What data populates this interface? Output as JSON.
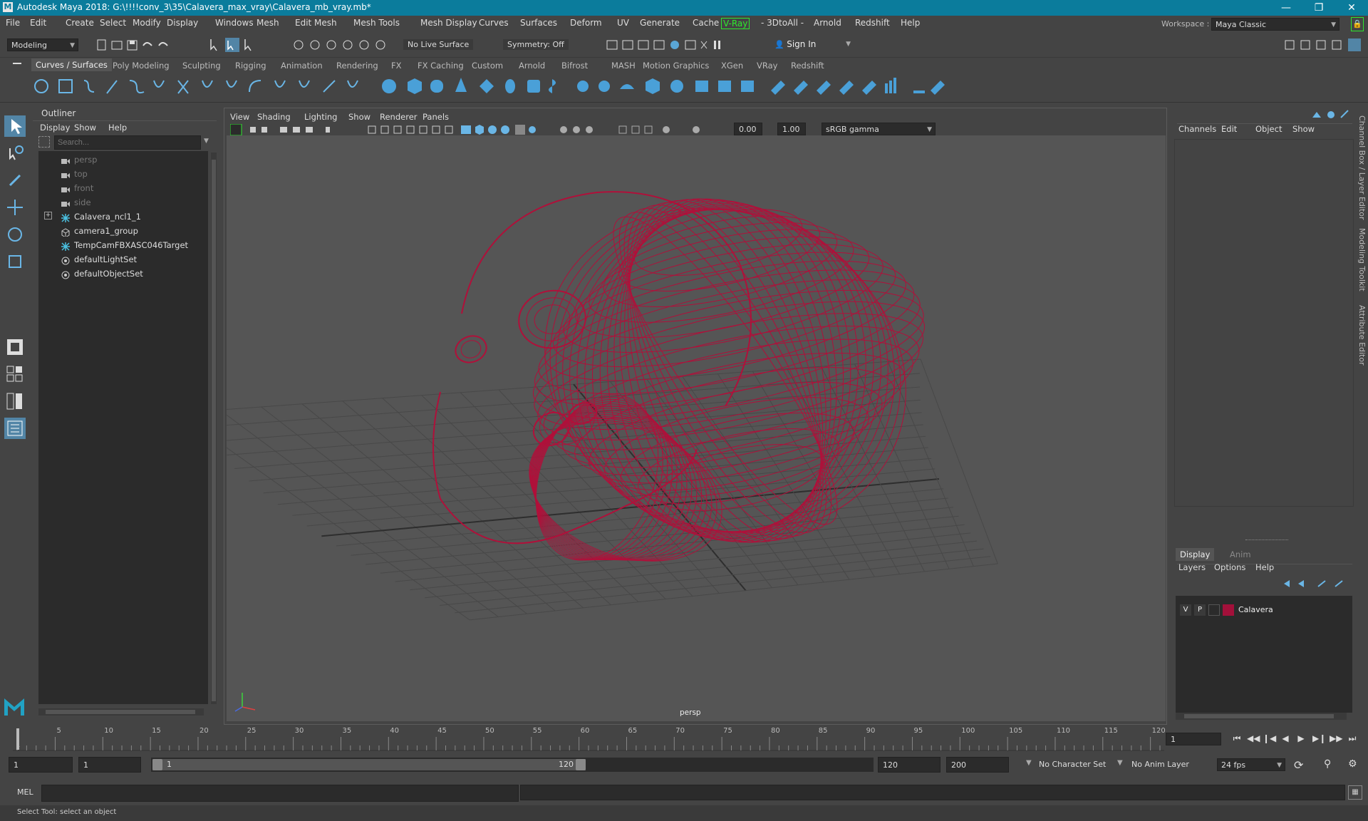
{
  "window": {
    "title": "Autodesk Maya 2018: G:\\!!!!conv_3\\35\\Calavera_max_vray\\Calavera_mb_vray.mb*"
  },
  "menubar": {
    "items": [
      "File",
      "Edit",
      "Create",
      "Select",
      "Modify",
      "Display",
      "Windows",
      "Mesh",
      "Edit Mesh",
      "Mesh Tools",
      "Mesh Display",
      "Curves",
      "Surfaces",
      "Deform",
      "UV",
      "Generate",
      "Cache",
      "V-Ray",
      "- 3DtoAll -",
      "Arnold",
      "Redshift",
      "Help"
    ]
  },
  "workspace": {
    "label": "Workspace :",
    "value": "Maya Classic"
  },
  "statusline": {
    "mode": "Modeling",
    "live_surface": "No Live Surface",
    "symmetry": "Symmetry: Off",
    "sign_in": "Sign In"
  },
  "shelf": {
    "tabs": [
      "Curves / Surfaces",
      "Poly Modeling",
      "Sculpting",
      "Rigging",
      "Animation",
      "Rendering",
      "FX",
      "FX Caching",
      "Custom",
      "Arnold",
      "Bifrost",
      "MASH",
      "Motion Graphics",
      "XGen",
      "VRay",
      "Redshift"
    ],
    "active": "Curves / Surfaces"
  },
  "outliner": {
    "title": "Outliner",
    "menu": [
      "Display",
      "Show",
      "Help"
    ],
    "search_placeholder": "Search...",
    "items": [
      {
        "label": "persp",
        "dim": true,
        "icon": "camera-icon"
      },
      {
        "label": "top",
        "dim": true,
        "icon": "camera-icon"
      },
      {
        "label": "front",
        "dim": true,
        "icon": "camera-icon"
      },
      {
        "label": "side",
        "dim": true,
        "icon": "camera-icon"
      },
      {
        "label": "Calavera_ncl1_1",
        "dim": false,
        "icon": "joint-icon",
        "expand": true
      },
      {
        "label": "camera1_group",
        "dim": false,
        "icon": "group-icon"
      },
      {
        "label": "TempCamFBXASC046Target",
        "dim": false,
        "icon": "joint-icon"
      },
      {
        "label": "defaultLightSet",
        "dim": false,
        "icon": "set-icon"
      },
      {
        "label": "defaultObjectSet",
        "dim": false,
        "icon": "set-icon"
      }
    ]
  },
  "viewport": {
    "menu": [
      "View",
      "Shading",
      "Lighting",
      "Show",
      "Renderer",
      "Panels"
    ],
    "exposure": "0.00",
    "gamma": "1.00",
    "color_space": "sRGB gamma",
    "camera_label": "persp",
    "wire_color": "#b0103a"
  },
  "channelbox": {
    "menu": [
      "Channels",
      "Edit",
      "Object",
      "Show"
    ],
    "side_tabs": [
      "Channel Box / Layer Editor",
      "Modeling Toolkit",
      "Attribute Editor"
    ]
  },
  "layers": {
    "tabs": [
      "Display",
      "Anim"
    ],
    "active_tab": "Display",
    "menu": [
      "Layers",
      "Options",
      "Help"
    ],
    "rows": [
      {
        "v": "V",
        "p": "P",
        "name": "Calavera",
        "color": "#a3103a"
      }
    ]
  },
  "timeline": {
    "ticks": [
      "5",
      "10",
      "15",
      "20",
      "25",
      "30",
      "35",
      "40",
      "45",
      "50",
      "55",
      "60",
      "65",
      "70",
      "75",
      "80",
      "85",
      "90",
      "95",
      "100",
      "105",
      "110",
      "115",
      "120"
    ],
    "start_tick": "1",
    "current_frame": "1"
  },
  "range": {
    "start": "1",
    "anim_start": "1",
    "slider_start": "1",
    "slider_end": "120",
    "end": "120",
    "anim_end": "200",
    "character_set": "No Character Set",
    "anim_layer": "No Anim Layer",
    "fps": "24 fps"
  },
  "cmdline": {
    "lang": "MEL"
  },
  "helpline": {
    "text": "Select Tool: select an object"
  }
}
